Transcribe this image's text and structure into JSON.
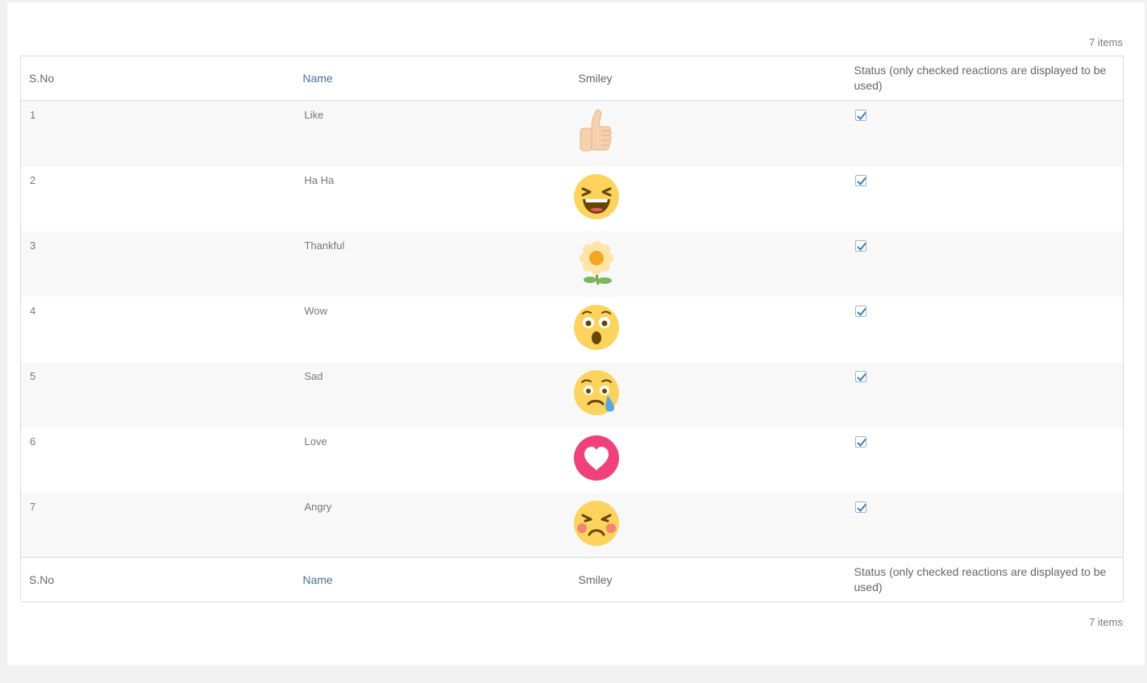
{
  "items_count": "7 items",
  "columns": {
    "sno": "S.No",
    "name": "Name",
    "smiley": "Smiley",
    "status": "Status (only checked reactions are displayed to be used)"
  },
  "rows": [
    {
      "sno": "1",
      "name": "Like",
      "icon": "thumbs-up-emoji",
      "checked": true
    },
    {
      "sno": "2",
      "name": "Ha Ha",
      "icon": "laughing-emoji",
      "checked": true
    },
    {
      "sno": "3",
      "name": "Thankful",
      "icon": "flower-emoji",
      "checked": true
    },
    {
      "sno": "4",
      "name": "Wow",
      "icon": "surprised-emoji",
      "checked": true
    },
    {
      "sno": "5",
      "name": "Sad",
      "icon": "crying-emoji",
      "checked": true
    },
    {
      "sno": "6",
      "name": "Love",
      "icon": "heart-emoji",
      "checked": true
    },
    {
      "sno": "7",
      "name": "Angry",
      "icon": "angry-emoji",
      "checked": true
    }
  ],
  "colors": {
    "link": "#4a6f9c",
    "checkbox_check": "#3a7fc1",
    "row_alt": "#f8f8f8"
  }
}
